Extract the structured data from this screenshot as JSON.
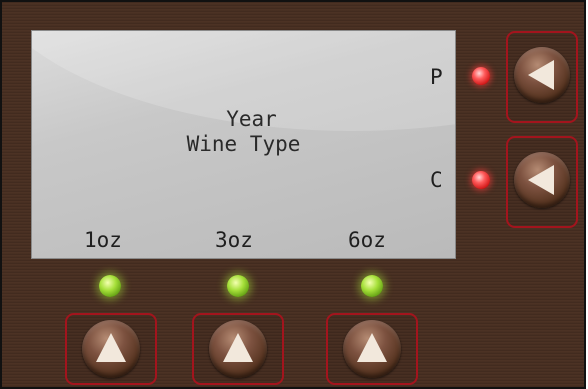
{
  "screen": {
    "line1": "Year",
    "line2": "Wine Type"
  },
  "labels": {
    "p": "P",
    "c": "C",
    "oz1": "1oz",
    "oz3": "3oz",
    "oz6": "6oz"
  },
  "colors": {
    "panel": "#4a3022",
    "frame": "#a3141d",
    "led_red": "#ff3c3c",
    "led_green": "#a6e03a",
    "arrow": "#f2e8dc"
  },
  "icons": {
    "right_buttons": "triangle-left-icon",
    "bottom_buttons": "triangle-up-icon"
  }
}
